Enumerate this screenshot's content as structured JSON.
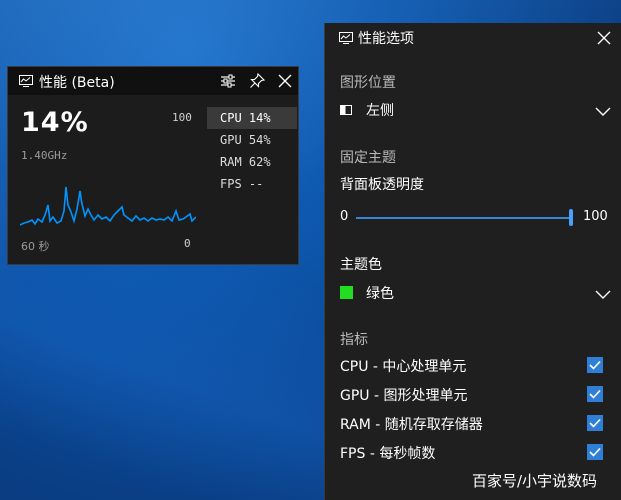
{
  "perf_widget": {
    "title": "性能 (Beta)",
    "big_value": "14%",
    "max_value": "100",
    "frequency": "1.40GHz",
    "time_span": "60 秒",
    "min_value": "0",
    "metrics": [
      {
        "label": "CPU 14%",
        "active": true
      },
      {
        "label": "GPU 54%",
        "active": false
      },
      {
        "label": "RAM 62%",
        "active": false
      },
      {
        "label": "FPS --",
        "active": false
      }
    ],
    "accent_color": "#0094ff"
  },
  "options_panel": {
    "title": "性能选项",
    "graph_position": {
      "heading": "图形位置",
      "selected": "左侧",
      "icon": "dock-left-icon"
    },
    "fixed_theme": {
      "heading": "固定主题",
      "opacity_label": "背面板透明度",
      "slider_min": "0",
      "slider_max": "100",
      "slider_value": 100
    },
    "theme_color": {
      "heading": "主题色",
      "selected": "绿色",
      "swatch_color": "#22dd22"
    },
    "metrics": {
      "heading": "指标",
      "items": [
        {
          "label": "CPU - 中心处理单元",
          "checked": true
        },
        {
          "label": "GPU - 图形处理单元",
          "checked": true
        },
        {
          "label": "RAM - 随机存取存储器",
          "checked": true
        },
        {
          "label": "FPS - 每秒帧数",
          "checked": true
        }
      ]
    }
  },
  "watermark": "百家号/小宇说数码"
}
